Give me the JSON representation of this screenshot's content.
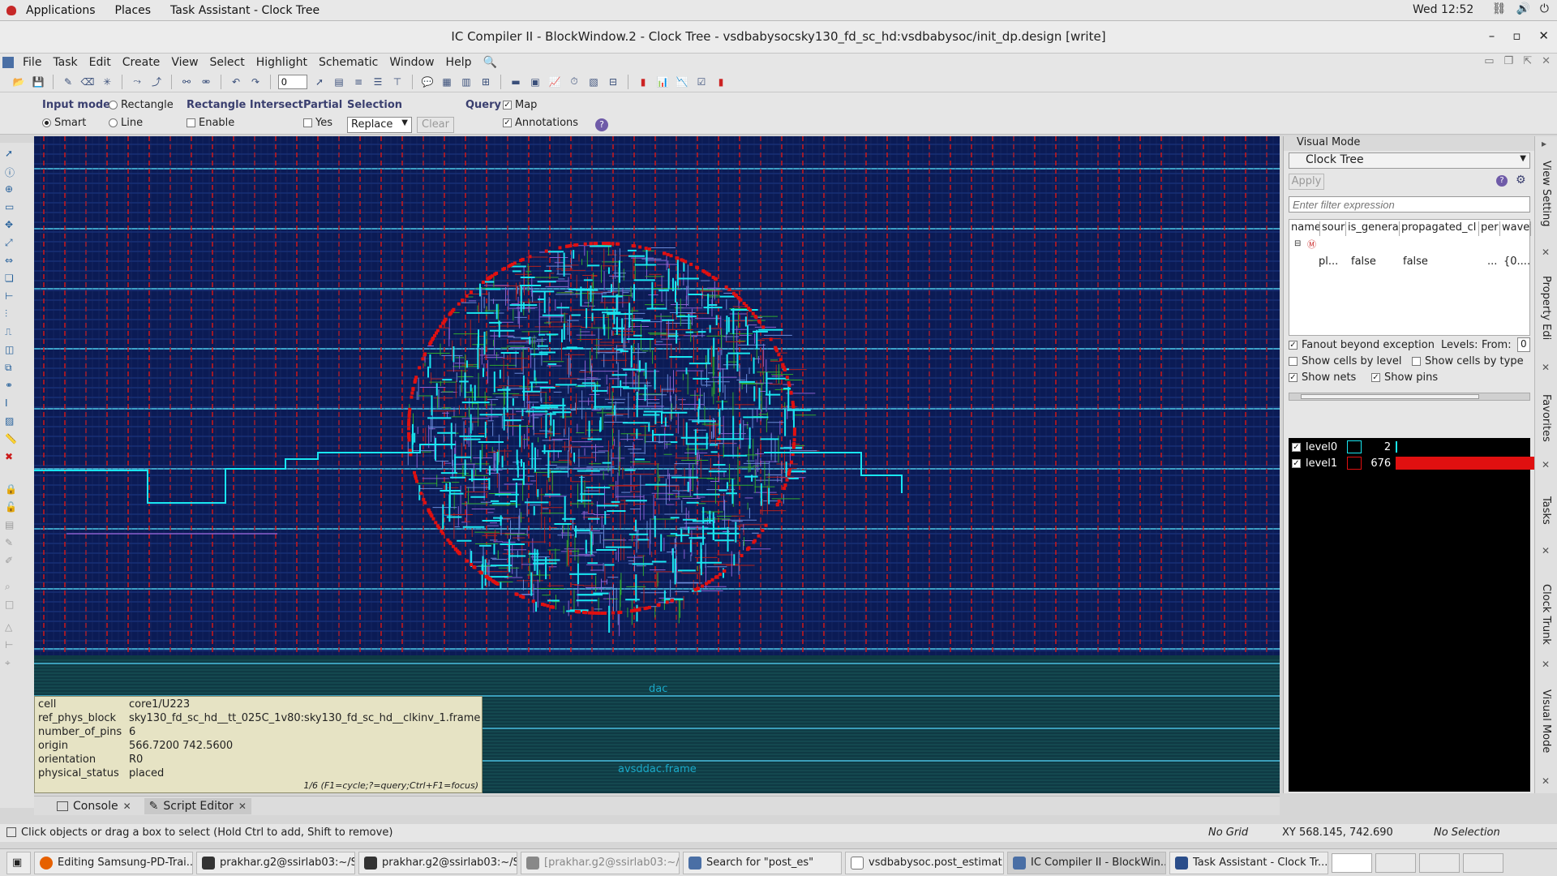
{
  "topbar": {
    "applications": "Applications",
    "places": "Places",
    "active_app": "Task Assistant - Clock Tree",
    "clock": "Wed 12:52"
  },
  "window": {
    "title": "IC Compiler II - BlockWindow.2 - Clock Tree - vsdbabysocsky130_fd_sc_hd:vsdbabysoc/init_dp.design [write]"
  },
  "menubar": {
    "items": [
      "File",
      "Task",
      "Edit",
      "Create",
      "View",
      "Select",
      "Highlight",
      "Schematic",
      "Window",
      "Help"
    ]
  },
  "toolbar": {
    "spin_value": "0"
  },
  "options": {
    "input_mode_label": "Input mode",
    "smart": "Smart",
    "rectangle": "Rectangle",
    "line": "Line",
    "rect_intersect_label": "Rectangle Intersect",
    "enable": "Enable",
    "partial_label": "Partial",
    "yes": "Yes",
    "selection_label": "Selection",
    "selection_value": "Replace",
    "clear": "Clear",
    "query_label": "Query",
    "map": "Map",
    "annotations": "Annotations"
  },
  "canvas": {
    "labels": {
      "dac": "dac",
      "avsddac": "avsddac.frame"
    },
    "colors": {
      "background": "#0b1b55",
      "clock_net": "#19e6f0",
      "red_track": "#d01818",
      "pg_line": "#4ac0e0",
      "green_net": "#2fa82f",
      "purple_net": "#8a60d0"
    }
  },
  "query_popup": {
    "rows": [
      {
        "key": "cell",
        "value": "core1/U223"
      },
      {
        "key": "ref_phys_block",
        "value": "sky130_fd_sc_hd__tt_025C_1v80:sky130_fd_sc_hd__clkinv_1.frame"
      },
      {
        "key": "number_of_pins",
        "value": "6"
      },
      {
        "key": "origin",
        "value": "566.7200 742.5600"
      },
      {
        "key": "orientation",
        "value": "R0"
      },
      {
        "key": "physical_status",
        "value": "placed"
      }
    ],
    "hint": "1/6 (F1=cycle;?=query;Ctrl+F1=focus)"
  },
  "bottom_tabs": {
    "console": "Console",
    "script_editor": "Script Editor"
  },
  "status": {
    "message": "Click objects or drag a box to select (Hold Ctrl to add, Shift to remove)",
    "grid": "No Grid",
    "coords": "XY 568.145, 742.690",
    "selection": "No Selection"
  },
  "right_panel": {
    "header": "Visual Mode",
    "mode": "Clock Tree",
    "apply": "Apply",
    "filter_placeholder": "Enter filter expression",
    "columns": [
      "name",
      "sour",
      "is_genera",
      "propagated_cl",
      "per",
      "wavef"
    ],
    "row": {
      "name": "pl...",
      "is_generated": "false",
      "propagated": "false",
      "period": "...",
      "waveform": "{0...."
    },
    "fanout": "Fanout beyond exception",
    "levels_label": "Levels:",
    "from_label": "From:",
    "from_value": "0",
    "show_cells_by_level": "Show cells by level",
    "show_cells_by_type": "Show cells by type",
    "show_nets": "Show nets",
    "show_pins": "Show pins",
    "levels": [
      {
        "name": "level0",
        "count": "2",
        "color": "#19e6f0"
      },
      {
        "name": "level1",
        "count": "676",
        "color": "#e01010"
      }
    ]
  },
  "side_tabs": [
    "View Setting",
    "Property Edi",
    "Favorites",
    "Tasks",
    "Clock Trunk",
    "Visual Mode"
  ],
  "taskbar": {
    "items": [
      "Editing Samsung-PD-Trai...",
      "prakhar.g2@ssirlab03:~/S...",
      "prakhar.g2@ssirlab03:~/S...",
      "[prakhar.g2@ssirlab03:~/...",
      "Search for \"post_es\"",
      "vsdbabysoc.post_estimat...",
      "IC Compiler II - BlockWin...",
      "Task Assistant - Clock Tr..."
    ]
  }
}
